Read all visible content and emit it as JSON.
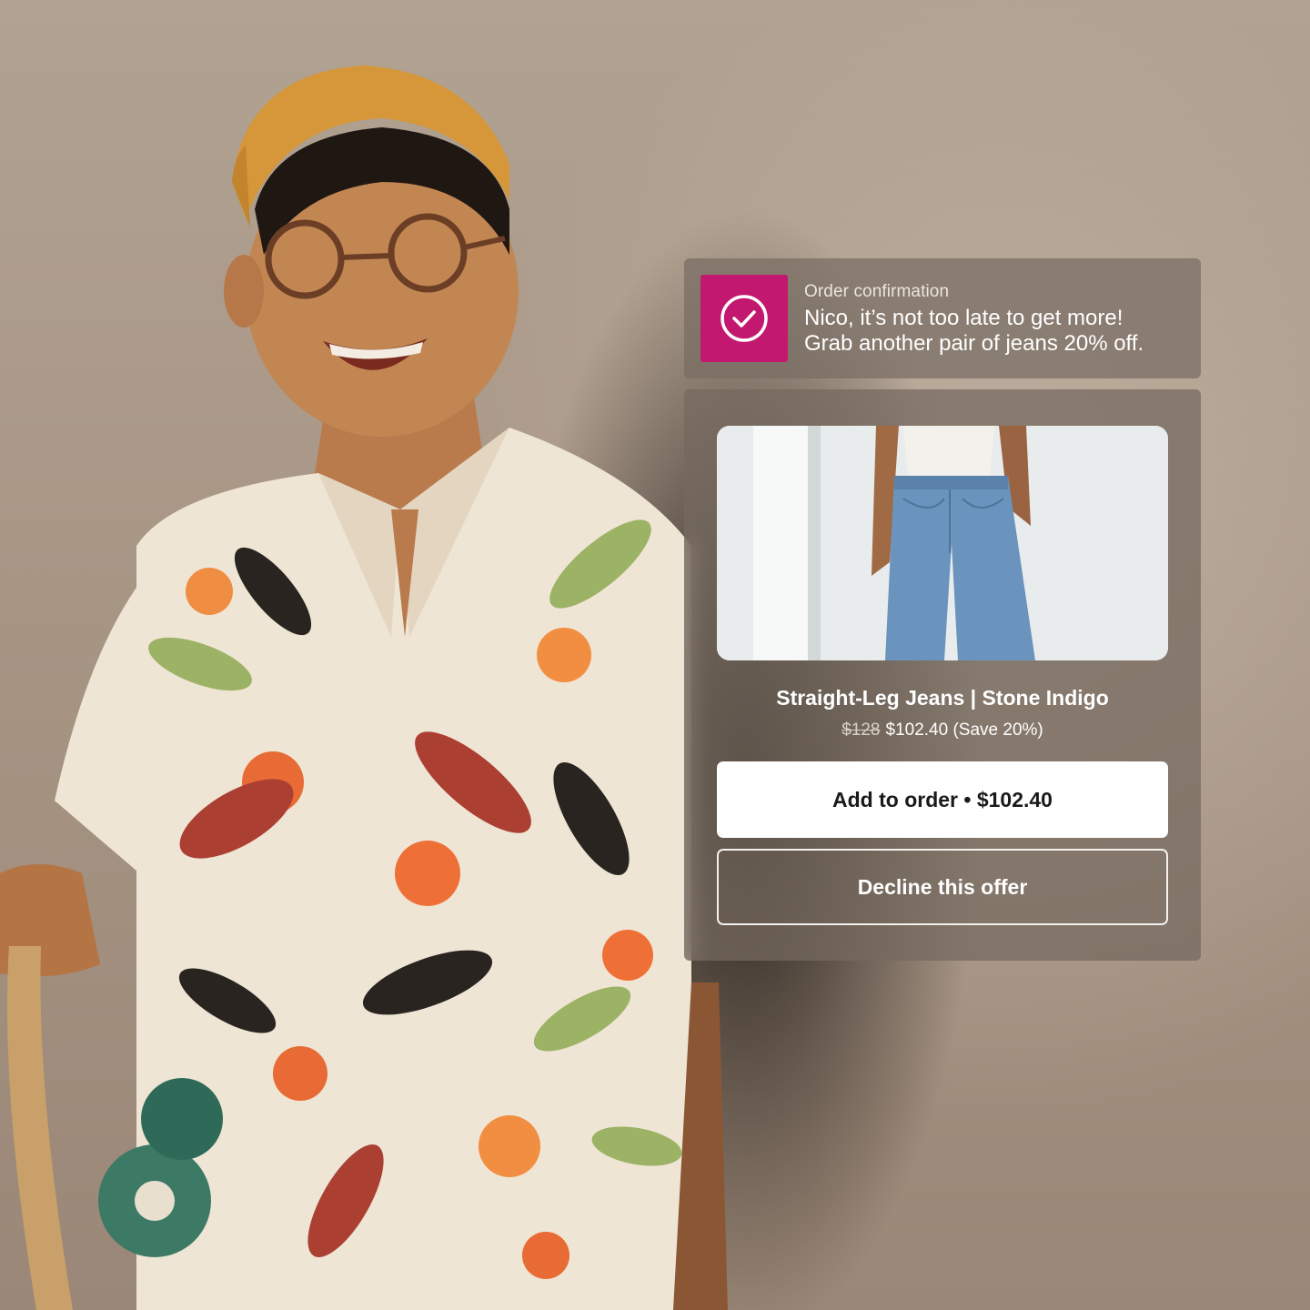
{
  "notification": {
    "label": "Order confirmation",
    "message_line1": "Nico, it’s not too late to get more!",
    "message_line2": "Grab another pair of jeans 20% off.",
    "icon": "check-circle-icon",
    "icon_bg": "#c2186f"
  },
  "offer": {
    "product_title": "Straight-Leg Jeans | Stone Indigo",
    "original_price": "$128",
    "sale_price": "$102.40",
    "savings": "(Save 20%)",
    "add_button_label": "Add to order • $102.40",
    "decline_button_label": "Decline this offer"
  }
}
